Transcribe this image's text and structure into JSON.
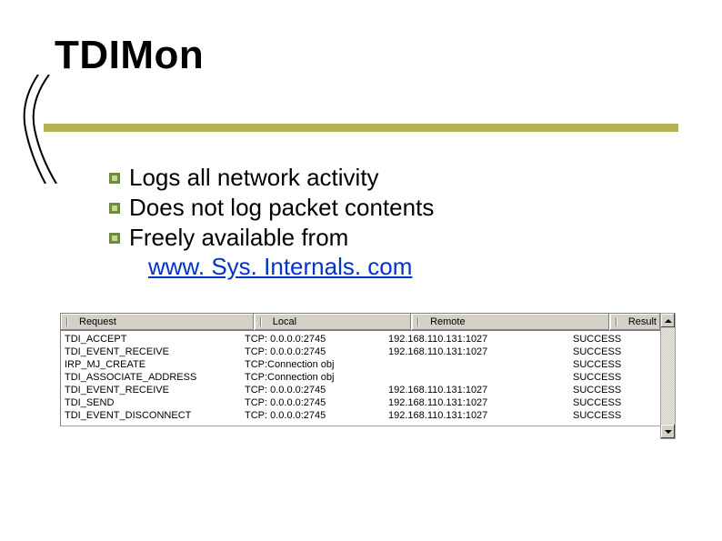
{
  "title": "TDIMon",
  "bullets": [
    "Logs all network activity",
    "Does not log packet contents",
    "Freely available from"
  ],
  "link_text": "www. Sys. Internals. com",
  "table": {
    "columns": [
      "Request",
      "Local",
      "Remote",
      "Result"
    ],
    "rows": [
      {
        "request": "TDI_ACCEPT",
        "local": "TCP: 0.0.0.0:2745",
        "remote": "192.168.110.131:1027",
        "result": "SUCCESS"
      },
      {
        "request": "TDI_EVENT_RECEIVE",
        "local": "TCP: 0.0.0.0:2745",
        "remote": "192.168.110.131:1027",
        "result": "SUCCESS"
      },
      {
        "request": "IRP_MJ_CREATE",
        "local": "TCP:Connection obj",
        "remote": "",
        "result": "SUCCESS"
      },
      {
        "request": "TDI_ASSOCIATE_ADDRESS",
        "local": "TCP:Connection obj",
        "remote": "",
        "result": "SUCCESS"
      },
      {
        "request": "TDI_EVENT_RECEIVE",
        "local": "TCP: 0.0.0.0:2745",
        "remote": "192.168.110.131:1027",
        "result": "SUCCESS"
      },
      {
        "request": "TDI_SEND",
        "local": "TCP: 0.0.0.0:2745",
        "remote": "192.168.110.131:1027",
        "result": "SUCCESS"
      },
      {
        "request": "TDI_EVENT_DISCONNECT",
        "local": "TCP: 0.0.0.0:2745",
        "remote": "192.168.110.131:1027",
        "result": "SUCCESS"
      }
    ]
  }
}
